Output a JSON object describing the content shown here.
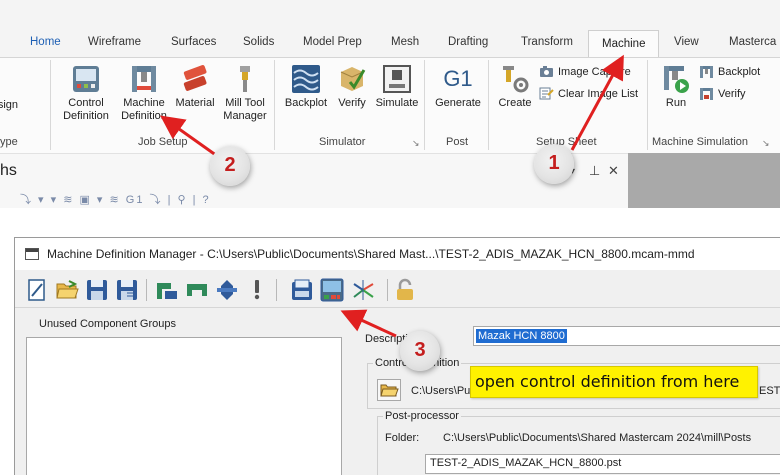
{
  "ribbon": {
    "tabs": [
      {
        "label": "Home"
      },
      {
        "label": "Wireframe"
      },
      {
        "label": "Surfaces"
      },
      {
        "label": "Solids"
      },
      {
        "label": "Model Prep"
      },
      {
        "label": "Mesh"
      },
      {
        "label": "Drafting"
      },
      {
        "label": "Transform"
      },
      {
        "label": "Machine"
      },
      {
        "label": "View"
      },
      {
        "label": "Masterca"
      }
    ],
    "left_cut": {
      "button_label": "sign",
      "group_label": "ype"
    },
    "job_setup": {
      "label": "Job Setup",
      "control_definition": "Control\nDefinition",
      "machine_definition": "Machine\nDefinition",
      "material": "Material",
      "mill_tool_manager": "Mill Tool\nManager"
    },
    "simulator": {
      "label": "Simulator",
      "backplot": "Backplot",
      "verify": "Verify",
      "simulate": "Simulate"
    },
    "post": {
      "label": "Post",
      "generate": "Generate",
      "g1_glyph": "G1"
    },
    "setup_sheet": {
      "label": "Setup Sheet",
      "create": "Create",
      "image_capture": "Image Capture",
      "clear_image_list": "Clear Image List"
    },
    "machine_simulation": {
      "label": "Machine Simulation",
      "run": "Run",
      "backplot": "Backplot",
      "verify": "Verify"
    }
  },
  "paths_pane": {
    "title": "hs",
    "tools": "⤵ ▾ ▾ ≋ ▣ ▾ ≋ G1 ⤵ | ⚲ | ?",
    "pin": "⊥",
    "close": "✕",
    "dropdown": "▾"
  },
  "dialog": {
    "title": "Machine Definition Manager - C:\\Users\\Public\\Documents\\Shared Mast...\\TEST-2_ADIS_MAZAK_HCN_8800.mcam-mmd",
    "unused_component_groups": "Unused Component Groups",
    "description_label": "Description:",
    "description_value": "Mazak HCN 8800",
    "control_definition_label": "Control Definition",
    "control_path": "C:\\Users\\Pub",
    "control_path_tail": "EST-",
    "postprocessor_label": "Post-processor",
    "folder_label": "Folder:",
    "folder_value": "C:\\Users\\Public\\Documents\\Shared Mastercam 2024\\mill\\Posts",
    "post_file": "TEST-2_ADIS_MAZAK_HCN_8800.pst"
  },
  "annotations": {
    "callout": "open control definition from here",
    "marker_1": "1",
    "marker_2": "2",
    "marker_3": "3",
    "arrow_color": "#e02020"
  },
  "colors": {
    "accent": "#1d5fb4",
    "selection": "#1f6cd1",
    "callout_bg": "#fff200",
    "annotation_red": "#c41e1e"
  }
}
